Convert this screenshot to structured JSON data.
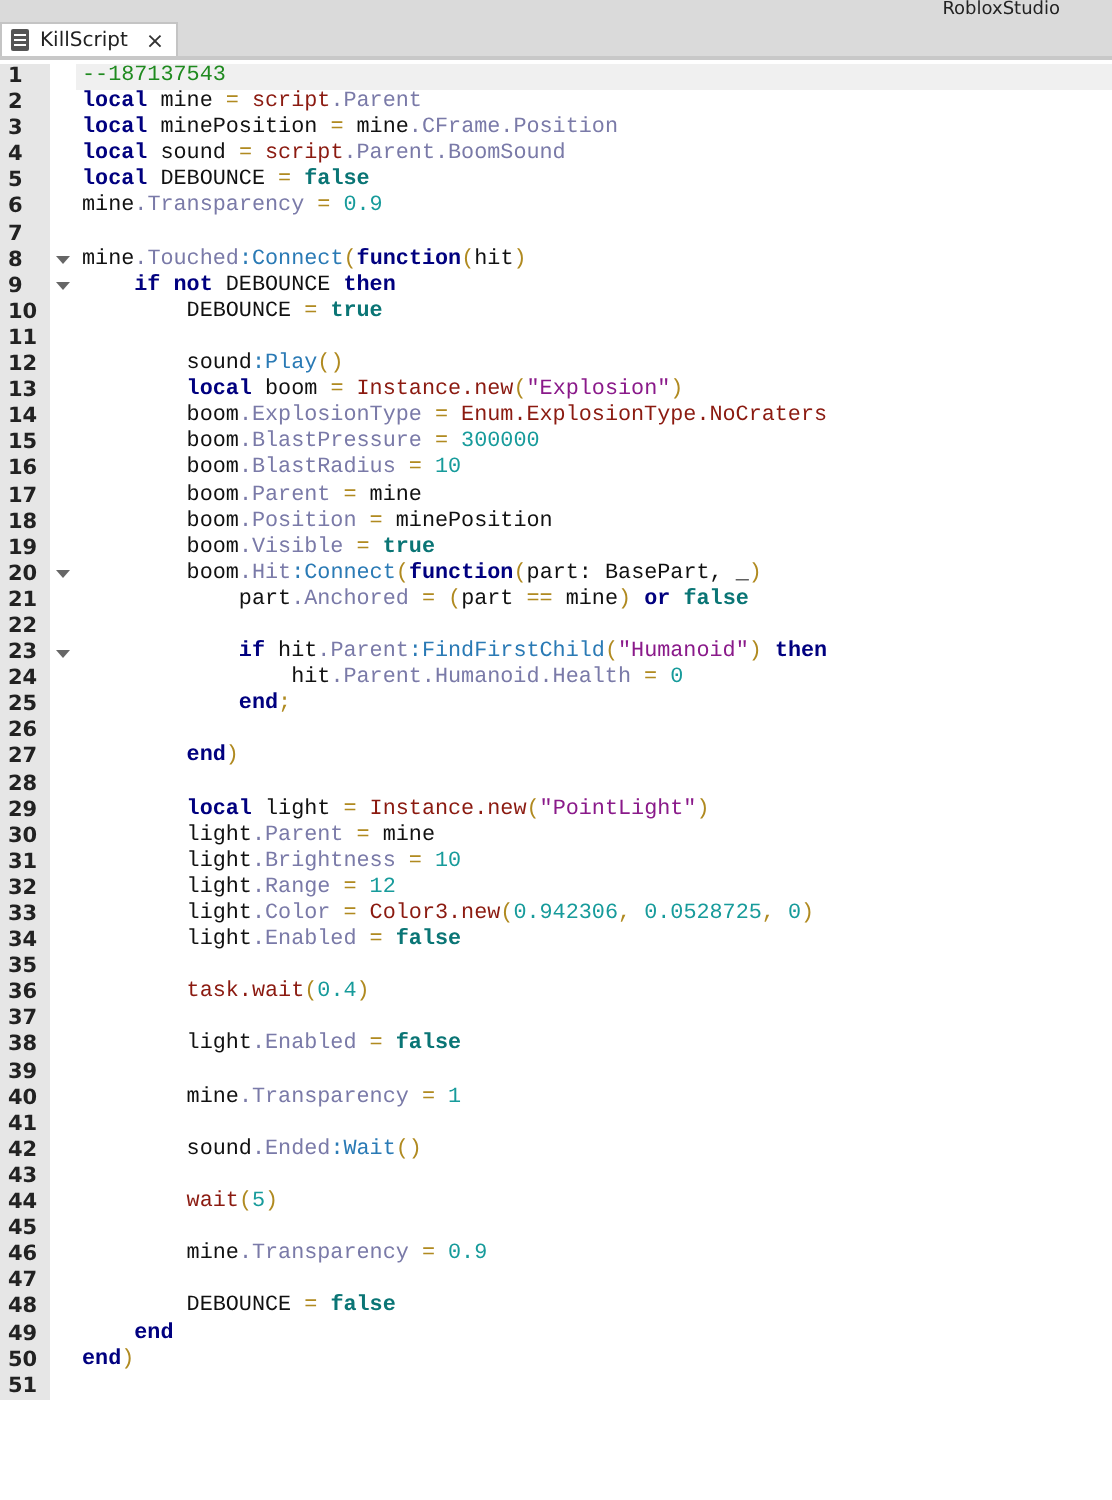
{
  "app_title": "RobloxStudio",
  "tabs": [
    {
      "label": "KillScript",
      "selected": true,
      "close": "×"
    }
  ],
  "lines": [
    {
      "number": "1",
      "current": true,
      "fold": false,
      "tokens": [
        {
          "kind": "c",
          "text": "--187137543"
        }
      ]
    },
    {
      "number": "2",
      "current": false,
      "fold": false,
      "tokens": [
        {
          "kind": "kw",
          "text": "local"
        },
        {
          "kind": "t",
          "text": " mine "
        },
        {
          "kind": "p",
          "text": "="
        },
        {
          "kind": "bi",
          "text": " script"
        },
        {
          "kind": "pr",
          "text": ".Parent"
        }
      ]
    },
    {
      "number": "3",
      "current": false,
      "fold": false,
      "tokens": [
        {
          "kind": "kw",
          "text": "local"
        },
        {
          "kind": "t",
          "text": " minePosition "
        },
        {
          "kind": "p",
          "text": "="
        },
        {
          "kind": "t",
          "text": " mine"
        },
        {
          "kind": "pr",
          "text": ".CFrame.Position"
        }
      ]
    },
    {
      "number": "4",
      "current": false,
      "fold": false,
      "tokens": [
        {
          "kind": "kw",
          "text": "local"
        },
        {
          "kind": "t",
          "text": " sound "
        },
        {
          "kind": "p",
          "text": "="
        },
        {
          "kind": "bi",
          "text": " script"
        },
        {
          "kind": "pr",
          "text": ".Parent.BoomSound"
        }
      ]
    },
    {
      "number": "5",
      "current": false,
      "fold": false,
      "tokens": [
        {
          "kind": "kw",
          "text": "local"
        },
        {
          "kind": "t",
          "text": " DEBOUNCE "
        },
        {
          "kind": "p",
          "text": "="
        },
        {
          "kind": "bool",
          "text": " false"
        }
      ]
    },
    {
      "number": "6",
      "current": false,
      "fold": false,
      "tokens": [
        {
          "kind": "t",
          "text": "mine"
        },
        {
          "kind": "pr",
          "text": ".Transparency"
        },
        {
          "kind": "p",
          "text": " ="
        },
        {
          "kind": "n",
          "text": " 0.9"
        }
      ]
    },
    {
      "number": "7",
      "current": false,
      "fold": false
    },
    {
      "number": "8",
      "current": false,
      "fold": true,
      "tokens": [
        {
          "kind": "t",
          "text": "mine"
        },
        {
          "kind": "pr",
          "text": ".Touched"
        },
        {
          "kind": "me",
          "text": ":Connect"
        },
        {
          "kind": "p",
          "text": "("
        },
        {
          "kind": "kw",
          "text": "function"
        },
        {
          "kind": "p",
          "text": "("
        },
        {
          "kind": "t",
          "text": "hit"
        },
        {
          "kind": "p",
          "text": ")"
        }
      ]
    },
    {
      "number": "9",
      "current": false,
      "fold": true,
      "tokens": [
        {
          "kind": "kw",
          "text": "    if not"
        },
        {
          "kind": "t",
          "text": " DEBOUNCE "
        },
        {
          "kind": "kw",
          "text": "then"
        }
      ]
    },
    {
      "number": "10",
      "current": false,
      "fold": false,
      "tokens": [
        {
          "kind": "t",
          "text": "        DEBOUNCE "
        },
        {
          "kind": "p",
          "text": "="
        },
        {
          "kind": "bool",
          "text": " true"
        }
      ]
    },
    {
      "number": "11",
      "current": false,
      "fold": false
    },
    {
      "number": "12",
      "current": false,
      "fold": false,
      "tokens": [
        {
          "kind": "t",
          "text": "        sound"
        },
        {
          "kind": "me",
          "text": ":Play"
        },
        {
          "kind": "p",
          "text": "()"
        }
      ]
    },
    {
      "number": "13",
      "current": false,
      "fold": false,
      "tokens": [
        {
          "kind": "kw",
          "text": "        local"
        },
        {
          "kind": "t",
          "text": " boom "
        },
        {
          "kind": "p",
          "text": "="
        },
        {
          "kind": "bi",
          "text": " Instance.new"
        },
        {
          "kind": "p",
          "text": "("
        },
        {
          "kind": "s",
          "text": "\"Explosion\""
        },
        {
          "kind": "p",
          "text": ")"
        }
      ]
    },
    {
      "number": "14",
      "current": false,
      "fold": false,
      "tokens": [
        {
          "kind": "t",
          "text": "        boom"
        },
        {
          "kind": "pr",
          "text": ".ExplosionType"
        },
        {
          "kind": "p",
          "text": " ="
        },
        {
          "kind": "bi",
          "text": " Enum.ExplosionType.NoCraters"
        }
      ]
    },
    {
      "number": "15",
      "current": false,
      "fold": false,
      "tokens": [
        {
          "kind": "t",
          "text": "        boom"
        },
        {
          "kind": "pr",
          "text": ".BlastPressure"
        },
        {
          "kind": "p",
          "text": " ="
        },
        {
          "kind": "n",
          "text": " 300000"
        }
      ]
    },
    {
      "number": "16",
      "current": false,
      "fold": false,
      "tokens": [
        {
          "kind": "t",
          "text": "        boom"
        },
        {
          "kind": "pr",
          "text": ".BlastRadius"
        },
        {
          "kind": "p",
          "text": " ="
        },
        {
          "kind": "n",
          "text": " 10"
        }
      ]
    },
    {
      "number": "17",
      "current": false,
      "fold": false,
      "tokens": [
        {
          "kind": "t",
          "text": "        boom"
        },
        {
          "kind": "pr",
          "text": ".Parent"
        },
        {
          "kind": "p",
          "text": " ="
        },
        {
          "kind": "t",
          "text": " mine"
        }
      ]
    },
    {
      "number": "18",
      "current": false,
      "fold": false,
      "tokens": [
        {
          "kind": "t",
          "text": "        boom"
        },
        {
          "kind": "pr",
          "text": ".Position"
        },
        {
          "kind": "p",
          "text": " ="
        },
        {
          "kind": "t",
          "text": " minePosition"
        }
      ]
    },
    {
      "number": "19",
      "current": false,
      "fold": false,
      "tokens": [
        {
          "kind": "t",
          "text": "        boom"
        },
        {
          "kind": "pr",
          "text": ".Visible"
        },
        {
          "kind": "p",
          "text": " ="
        },
        {
          "kind": "bool",
          "text": " true"
        }
      ]
    },
    {
      "number": "20",
      "current": false,
      "fold": true,
      "tokens": [
        {
          "kind": "t",
          "text": "        boom"
        },
        {
          "kind": "pr",
          "text": ".Hit"
        },
        {
          "kind": "me",
          "text": ":Connect"
        },
        {
          "kind": "p",
          "text": "("
        },
        {
          "kind": "kw",
          "text": "function"
        },
        {
          "kind": "p",
          "text": "("
        },
        {
          "kind": "t",
          "text": "part: BasePart, _"
        },
        {
          "kind": "p",
          "text": ")"
        }
      ]
    },
    {
      "number": "21",
      "current": false,
      "fold": false,
      "tokens": [
        {
          "kind": "t",
          "text": "            part"
        },
        {
          "kind": "pr",
          "text": ".Anchored"
        },
        {
          "kind": "p",
          "text": " = ("
        },
        {
          "kind": "t",
          "text": "part "
        },
        {
          "kind": "p",
          "text": "=="
        },
        {
          "kind": "t",
          "text": " mine"
        },
        {
          "kind": "p",
          "text": ")"
        },
        {
          "kind": "kw",
          "text": " or"
        },
        {
          "kind": "bool",
          "text": " false"
        }
      ]
    },
    {
      "number": "22",
      "current": false,
      "fold": false
    },
    {
      "number": "23",
      "current": false,
      "fold": true,
      "tokens": [
        {
          "kind": "kw",
          "text": "            if"
        },
        {
          "kind": "t",
          "text": " hit"
        },
        {
          "kind": "pr",
          "text": ".Parent"
        },
        {
          "kind": "me",
          "text": ":FindFirstChild"
        },
        {
          "kind": "p",
          "text": "("
        },
        {
          "kind": "s",
          "text": "\"Humanoid\""
        },
        {
          "kind": "p",
          "text": ")"
        },
        {
          "kind": "kw",
          "text": " then"
        }
      ]
    },
    {
      "number": "24",
      "current": false,
      "fold": false,
      "tokens": [
        {
          "kind": "t",
          "text": "                hit"
        },
        {
          "kind": "pr",
          "text": ".Parent.Humanoid.Health"
        },
        {
          "kind": "p",
          "text": " ="
        },
        {
          "kind": "n",
          "text": " 0"
        }
      ]
    },
    {
      "number": "25",
      "current": false,
      "fold": false,
      "tokens": [
        {
          "kind": "kw",
          "text": "            end"
        },
        {
          "kind": "p",
          "text": ";"
        }
      ]
    },
    {
      "number": "26",
      "current": false,
      "fold": false
    },
    {
      "number": "27",
      "current": false,
      "fold": false,
      "tokens": [
        {
          "kind": "kw",
          "text": "        end"
        },
        {
          "kind": "p",
          "text": ")"
        }
      ]
    },
    {
      "number": "28",
      "current": false,
      "fold": false
    },
    {
      "number": "29",
      "current": false,
      "fold": false,
      "tokens": [
        {
          "kind": "kw",
          "text": "        local"
        },
        {
          "kind": "t",
          "text": " light "
        },
        {
          "kind": "p",
          "text": "="
        },
        {
          "kind": "bi",
          "text": " Instance.new"
        },
        {
          "kind": "p",
          "text": "("
        },
        {
          "kind": "s",
          "text": "\"PointLight\""
        },
        {
          "kind": "p",
          "text": ")"
        }
      ]
    },
    {
      "number": "30",
      "current": false,
      "fold": false,
      "tokens": [
        {
          "kind": "t",
          "text": "        light"
        },
        {
          "kind": "pr",
          "text": ".Parent"
        },
        {
          "kind": "p",
          "text": " ="
        },
        {
          "kind": "t",
          "text": " mine"
        }
      ]
    },
    {
      "number": "31",
      "current": false,
      "fold": false,
      "tokens": [
        {
          "kind": "t",
          "text": "        light"
        },
        {
          "kind": "pr",
          "text": ".Brightness"
        },
        {
          "kind": "p",
          "text": " ="
        },
        {
          "kind": "n",
          "text": " 10"
        }
      ]
    },
    {
      "number": "32",
      "current": false,
      "fold": false,
      "tokens": [
        {
          "kind": "t",
          "text": "        light"
        },
        {
          "kind": "pr",
          "text": ".Range"
        },
        {
          "kind": "p",
          "text": " ="
        },
        {
          "kind": "n",
          "text": " 12"
        }
      ]
    },
    {
      "number": "33",
      "current": false,
      "fold": false,
      "tokens": [
        {
          "kind": "t",
          "text": "        light"
        },
        {
          "kind": "pr",
          "text": ".Color"
        },
        {
          "kind": "p",
          "text": " ="
        },
        {
          "kind": "bi",
          "text": " Color3.new"
        },
        {
          "kind": "p",
          "text": "("
        },
        {
          "kind": "n",
          "text": "0.942306"
        },
        {
          "kind": "p",
          "text": ","
        },
        {
          "kind": "n",
          "text": " 0.0528725"
        },
        {
          "kind": "p",
          "text": ","
        },
        {
          "kind": "n",
          "text": " 0"
        },
        {
          "kind": "p",
          "text": ")"
        }
      ]
    },
    {
      "number": "34",
      "current": false,
      "fold": false,
      "tokens": [
        {
          "kind": "t",
          "text": "        light"
        },
        {
          "kind": "pr",
          "text": ".Enabled"
        },
        {
          "kind": "p",
          "text": " ="
        },
        {
          "kind": "bool",
          "text": " false"
        }
      ]
    },
    {
      "number": "35",
      "current": false,
      "fold": false
    },
    {
      "number": "36",
      "current": false,
      "fold": false,
      "tokens": [
        {
          "kind": "bi",
          "text": "        task.wait"
        },
        {
          "kind": "p",
          "text": "("
        },
        {
          "kind": "n",
          "text": "0.4"
        },
        {
          "kind": "p",
          "text": ")"
        }
      ]
    },
    {
      "number": "37",
      "current": false,
      "fold": false
    },
    {
      "number": "38",
      "current": false,
      "fold": false,
      "tokens": [
        {
          "kind": "t",
          "text": "        light"
        },
        {
          "kind": "pr",
          "text": ".Enabled"
        },
        {
          "kind": "p",
          "text": " ="
        },
        {
          "kind": "bool",
          "text": " false"
        }
      ]
    },
    {
      "number": "39",
      "current": false,
      "fold": false
    },
    {
      "number": "40",
      "current": false,
      "fold": false,
      "tokens": [
        {
          "kind": "t",
          "text": "        mine"
        },
        {
          "kind": "pr",
          "text": ".Transparency"
        },
        {
          "kind": "p",
          "text": " ="
        },
        {
          "kind": "n",
          "text": " 1"
        }
      ]
    },
    {
      "number": "41",
      "current": false,
      "fold": false
    },
    {
      "number": "42",
      "current": false,
      "fold": false,
      "tokens": [
        {
          "kind": "t",
          "text": "        sound"
        },
        {
          "kind": "pr",
          "text": ".Ended"
        },
        {
          "kind": "me",
          "text": ":Wait"
        },
        {
          "kind": "p",
          "text": "()"
        }
      ]
    },
    {
      "number": "43",
      "current": false,
      "fold": false
    },
    {
      "number": "44",
      "current": false,
      "fold": false,
      "tokens": [
        {
          "kind": "bi",
          "text": "        wait"
        },
        {
          "kind": "p",
          "text": "("
        },
        {
          "kind": "n",
          "text": "5"
        },
        {
          "kind": "p",
          "text": ")"
        }
      ]
    },
    {
      "number": "45",
      "current": false,
      "fold": false
    },
    {
      "number": "46",
      "current": false,
      "fold": false,
      "tokens": [
        {
          "kind": "t",
          "text": "        mine"
        },
        {
          "kind": "pr",
          "text": ".Transparency"
        },
        {
          "kind": "p",
          "text": " ="
        },
        {
          "kind": "n",
          "text": " 0.9"
        }
      ]
    },
    {
      "number": "47",
      "current": false,
      "fold": false
    },
    {
      "number": "48",
      "current": false,
      "fold": false,
      "tokens": [
        {
          "kind": "t",
          "text": "        DEBOUNCE "
        },
        {
          "kind": "p",
          "text": "="
        },
        {
          "kind": "bool",
          "text": " false"
        }
      ]
    },
    {
      "number": "49",
      "current": false,
      "fold": false,
      "tokens": [
        {
          "kind": "kw",
          "text": "    end"
        }
      ]
    },
    {
      "number": "50",
      "current": false,
      "fold": false,
      "tokens": [
        {
          "kind": "kw",
          "text": "end"
        },
        {
          "kind": "p",
          "text": ")"
        }
      ]
    },
    {
      "number": "51",
      "current": false,
      "fold": false
    }
  ]
}
